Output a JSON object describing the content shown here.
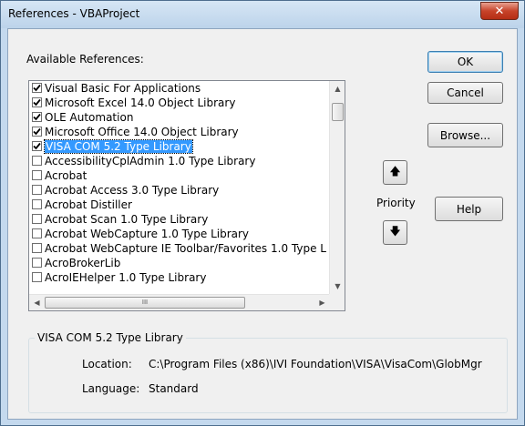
{
  "window": {
    "title": "References - VBAProject",
    "close_glyph": "✕"
  },
  "available_label": "Available References:",
  "references": [
    {
      "label": "Visual Basic For Applications",
      "checked": true,
      "selected": false
    },
    {
      "label": "Microsoft Excel 14.0 Object Library",
      "checked": true,
      "selected": false
    },
    {
      "label": "OLE Automation",
      "checked": true,
      "selected": false
    },
    {
      "label": "Microsoft Office 14.0 Object Library",
      "checked": true,
      "selected": false
    },
    {
      "label": "VISA COM 5.2 Type Library",
      "checked": true,
      "selected": true
    },
    {
      "label": "AccessibilityCplAdmin 1.0 Type Library",
      "checked": false,
      "selected": false
    },
    {
      "label": "Acrobat",
      "checked": false,
      "selected": false
    },
    {
      "label": "Acrobat Access 3.0 Type Library",
      "checked": false,
      "selected": false
    },
    {
      "label": "Acrobat Distiller",
      "checked": false,
      "selected": false
    },
    {
      "label": "Acrobat Scan 1.0 Type Library",
      "checked": false,
      "selected": false
    },
    {
      "label": "Acrobat WebCapture 1.0 Type Library",
      "checked": false,
      "selected": false
    },
    {
      "label": "Acrobat WebCapture IE Toolbar/Favorites 1.0 Type L",
      "checked": false,
      "selected": false
    },
    {
      "label": "AcroBrokerLib",
      "checked": false,
      "selected": false
    },
    {
      "label": "AcroIEHelper 1.0 Type Library",
      "checked": false,
      "selected": false
    }
  ],
  "buttons": {
    "ok": "OK",
    "cancel": "Cancel",
    "browse": "Browse...",
    "help": "Help"
  },
  "priority": {
    "label": "Priority",
    "up_glyph": "🡅",
    "down_glyph": "🡇"
  },
  "scroll": {
    "up_glyph": "▲",
    "down_glyph": "▼",
    "left_glyph": "◀",
    "right_glyph": "▶",
    "grip_glyph": "III"
  },
  "details": {
    "title": "VISA COM 5.2 Type Library",
    "location_label": "Location:",
    "location_value": "C:\\Program Files (x86)\\IVI Foundation\\VISA\\VisaCom\\GlobMgr",
    "language_label": "Language:",
    "language_value": "Standard"
  }
}
